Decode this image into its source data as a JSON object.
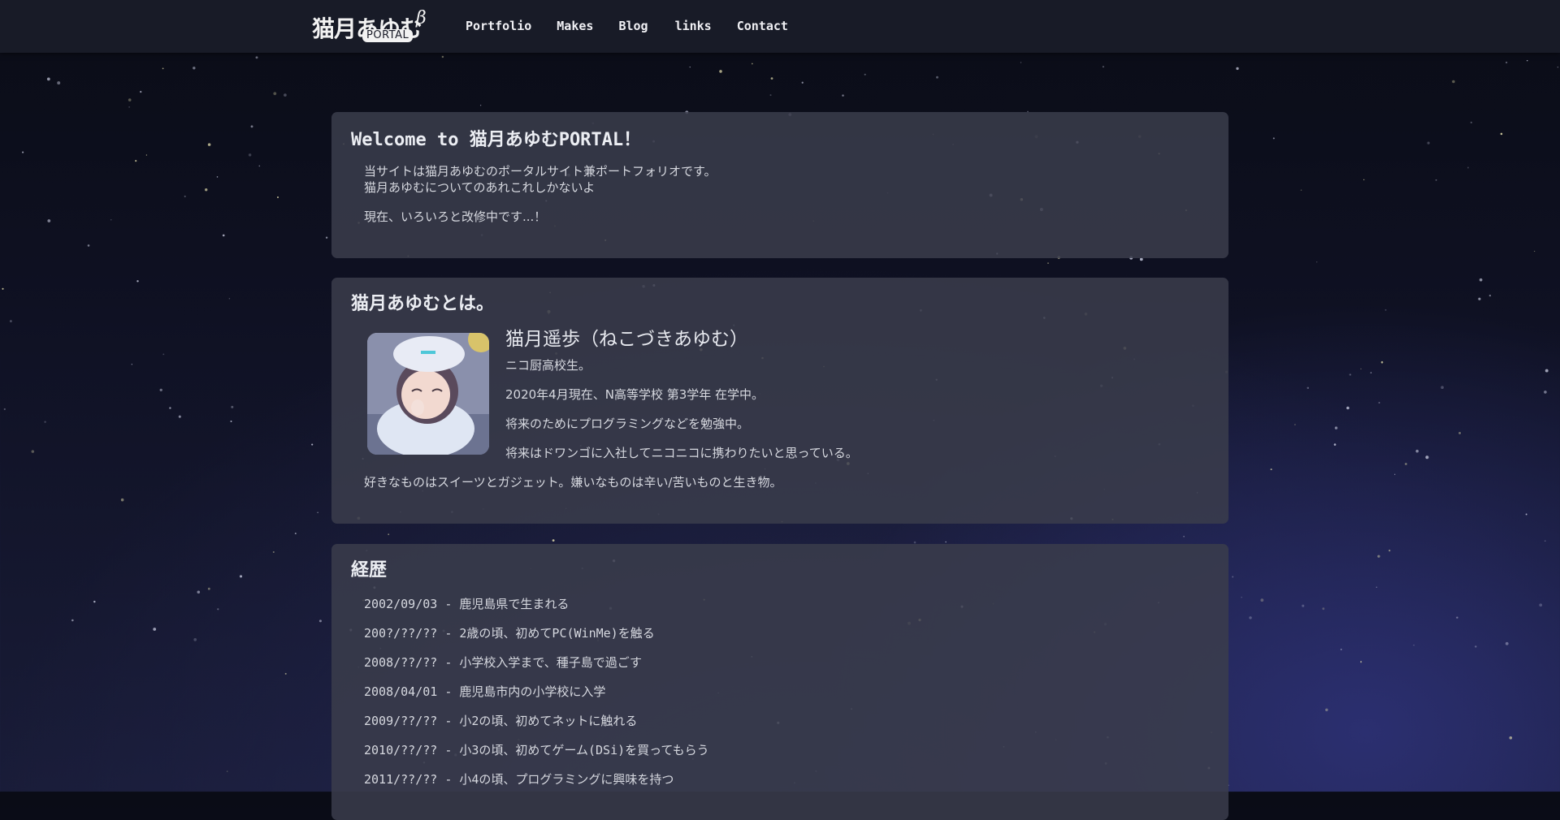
{
  "site": {
    "logo_text": "猫月あゆむ",
    "logo_sub": "PORTAL",
    "logo_beta": "β"
  },
  "nav": {
    "items": [
      "Portfolio",
      "Makes",
      "Blog",
      "links",
      "Contact"
    ]
  },
  "welcome": {
    "title": "Welcome to 猫月あゆむPORTAL！",
    "line1": "当サイトは猫月あゆむのポータルサイト兼ポートフォリオです。",
    "line2": "猫月あゆむについてのあれこれしかないよ",
    "line3": "現在、いろいろと改修中です...！"
  },
  "about": {
    "title": "猫月あゆむとは。",
    "name": "猫月遥歩（ねこづきあゆむ）",
    "lines": [
      "ニコ厨高校生。",
      "2020年4月現在、N高等学校 第3学年 在学中。",
      "将来のためにプログラミングなどを勉強中。",
      "将来はドワンゴに入社してニコニコに携わりたいと思っている。"
    ],
    "likes": "好きなものはスイーツとガジェット。嫌いなものは辛い/苦いものと生き物。"
  },
  "history": {
    "title": "経歴",
    "items": [
      "2002/09/03 - 鹿児島県で生まれる",
      "200?/??/?? - 2歳の頃、初めてPC(WinMe)を触る",
      "2008/??/?? - 小学校入学まで、種子島で過ごす",
      "2008/04/01 - 鹿児島市内の小学校に入学",
      "2009/??/?? - 小2の頃、初めてネットに触れる",
      "2010/??/?? - 小3の頃、初めてゲーム(DSi)を買ってもらう",
      "2011/??/?? - 小4の頃、プログラミングに興味を持つ"
    ]
  },
  "colors": {
    "topbar": "#181b27",
    "card": "#3a3d4c",
    "text": "#d6d8df"
  }
}
